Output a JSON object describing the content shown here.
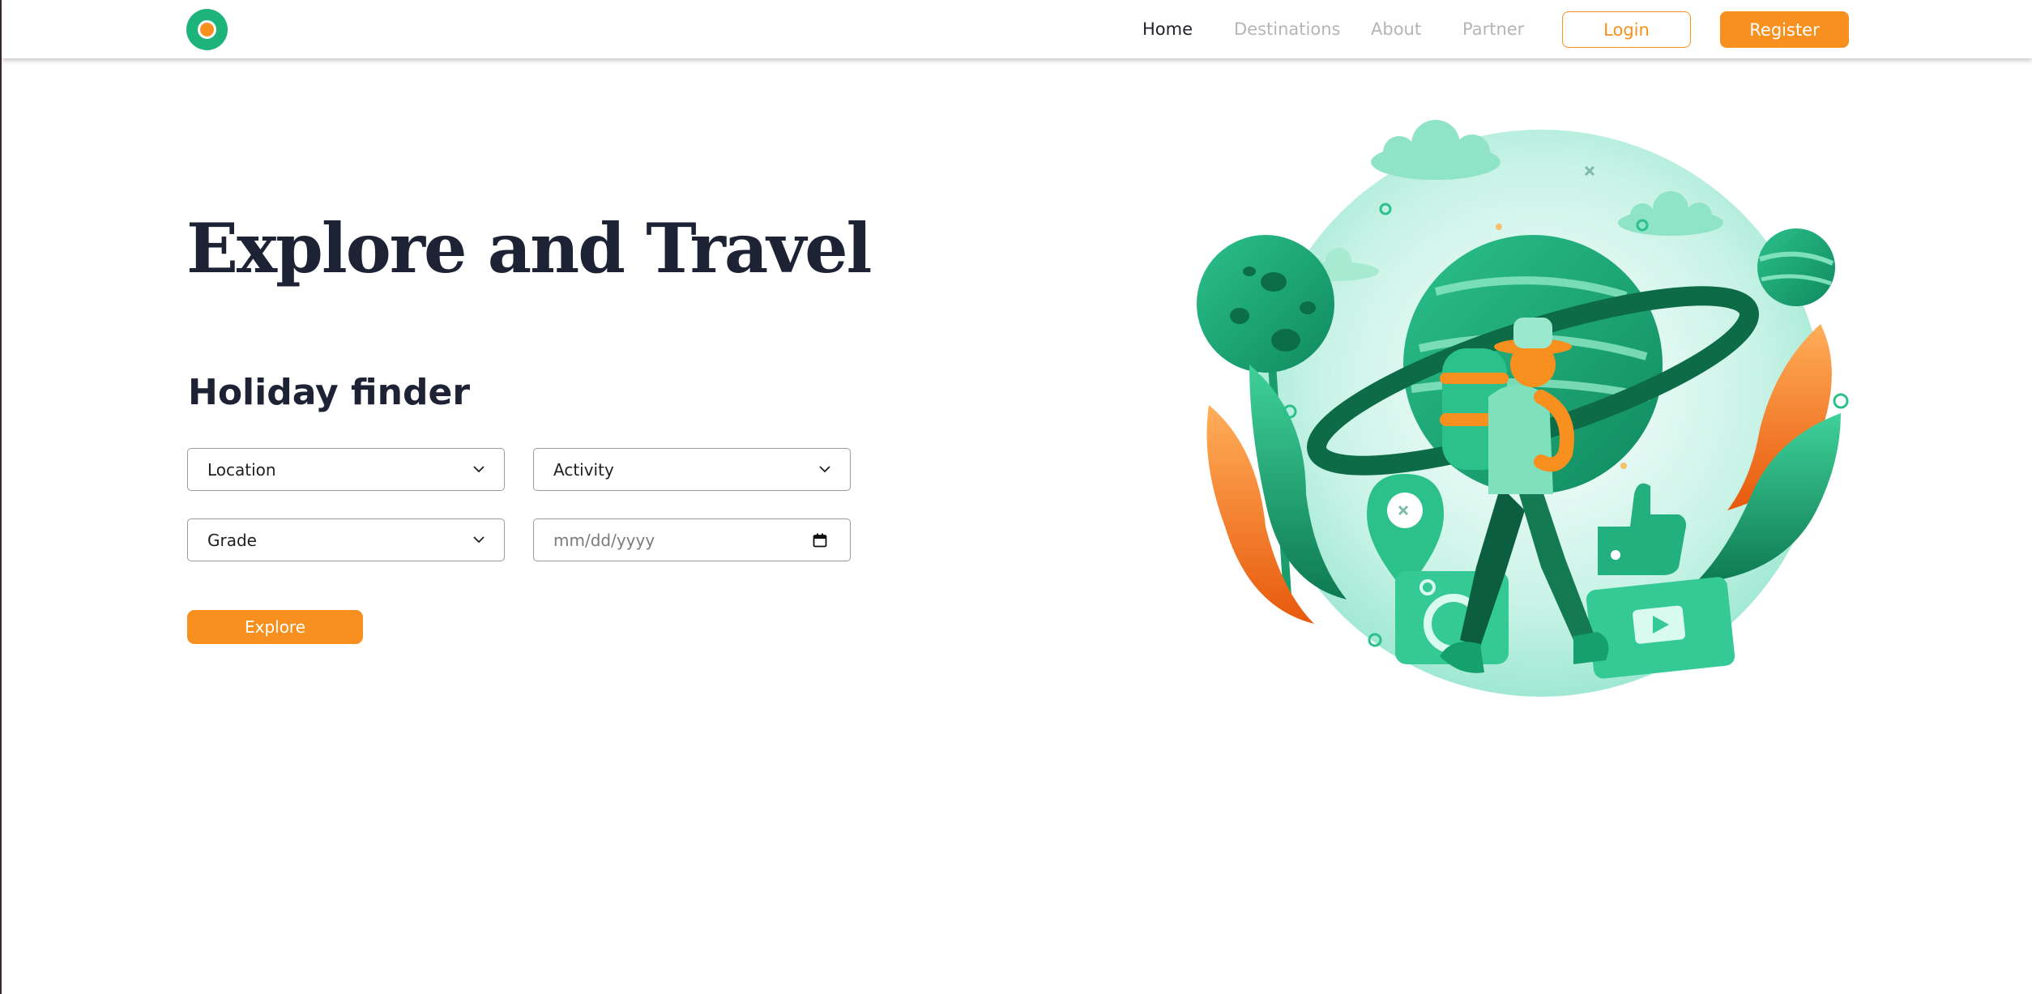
{
  "nav": {
    "links": [
      {
        "label": "Home",
        "active": true
      },
      {
        "label": "Destinations",
        "active": false
      },
      {
        "label": "About",
        "active": false
      },
      {
        "label": "Partner",
        "active": false
      }
    ],
    "login_label": "Login",
    "register_label": "Register"
  },
  "hero": {
    "title": "Explore and Travel"
  },
  "finder": {
    "title": "Holiday finder",
    "location": {
      "value": "Location",
      "icon": "chevron-down-icon"
    },
    "activity": {
      "value": "Activity",
      "icon": "chevron-down-icon"
    },
    "grade": {
      "value": "Grade",
      "icon": "chevron-down-icon"
    },
    "date": {
      "placeholder": "mm/dd/yyyy",
      "icon": "calendar-icon"
    },
    "explore_label": "Explore"
  },
  "colors": {
    "brand_green": "#1fb37c",
    "brand_orange": "#f7901e",
    "heading": "#1e2235",
    "nav_inactive": "#b5b5b5"
  },
  "illustration": {
    "icon": "traveler-planet-illustration"
  }
}
